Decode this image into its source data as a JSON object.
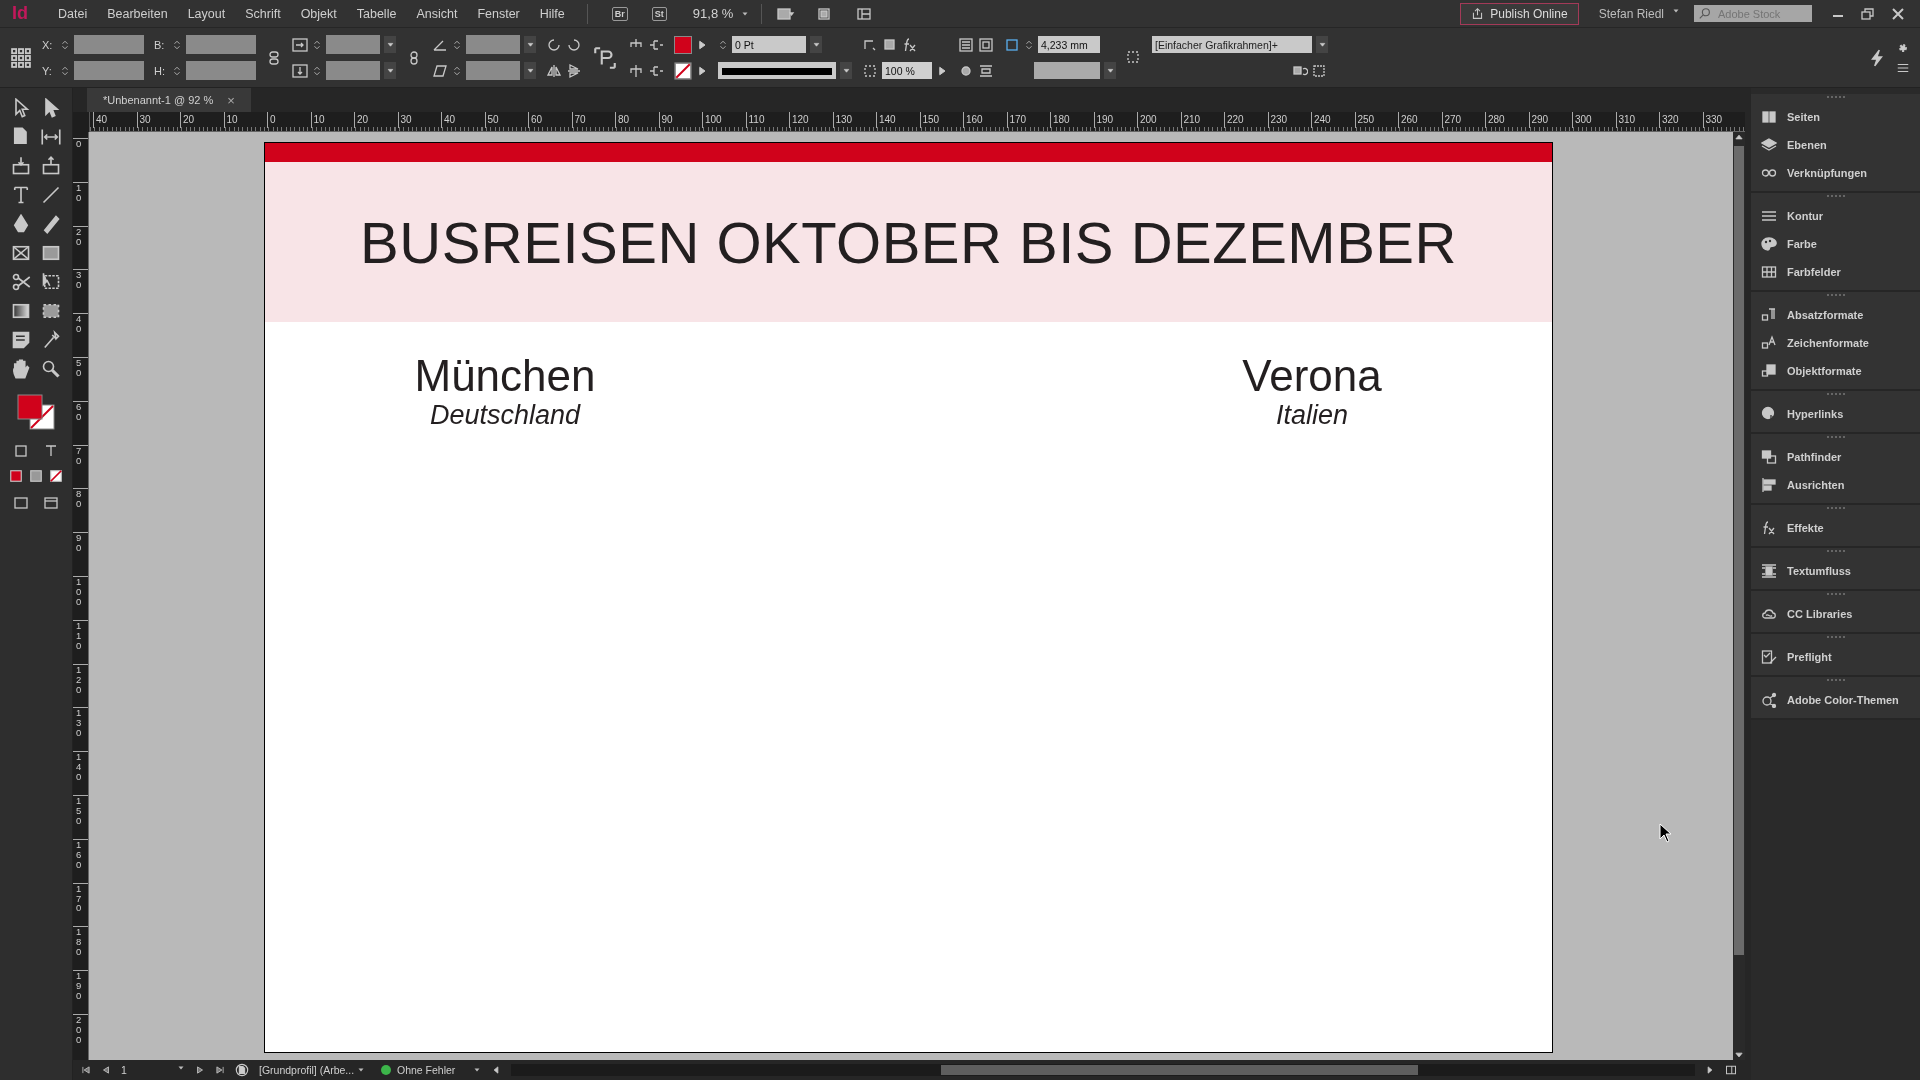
{
  "menubar": {
    "logo": "Id",
    "menus": [
      "Datei",
      "Bearbeiten",
      "Layout",
      "Schrift",
      "Objekt",
      "Tabelle",
      "Ansicht",
      "Fenster",
      "Hilfe"
    ],
    "bridge": "Br",
    "stock": "St",
    "zoom": "91,8 %",
    "publish": "Publish Online",
    "user": "Stefan Riedl",
    "search": {
      "placeholder": "Adobe Stock"
    }
  },
  "control_panel": {
    "x_label": "X:",
    "y_label": "Y:",
    "w_label": "B:",
    "h_label": "H:",
    "stroke_weight": "0 Pt",
    "opacity": "100 %",
    "size": "4,233 mm",
    "object_style": "[Einfacher Grafikrahmen]+"
  },
  "document_tab": {
    "title": "*Unbenannt-1 @ 92 %",
    "close": "×"
  },
  "rulers": {
    "horizontal": [
      "40",
      "30",
      "20",
      "10",
      "0",
      "10",
      "20",
      "30",
      "40",
      "50",
      "60",
      "70",
      "80",
      "90",
      "100",
      "110",
      "120",
      "130",
      "140",
      "150",
      "160",
      "170",
      "180",
      "190",
      "200",
      "210",
      "220",
      "230",
      "240",
      "250",
      "260",
      "270",
      "280",
      "290",
      "300",
      "310",
      "320",
      "330"
    ],
    "vertical": [
      "0",
      "10",
      "20",
      "30",
      "40",
      "50",
      "60",
      "70",
      "80",
      "90",
      "100",
      "110",
      "120",
      "130",
      "140",
      "150",
      "160",
      "170",
      "180",
      "190",
      "200"
    ]
  },
  "page": {
    "title": "BUSREISEN OKTOBER BIS DEZEMBER",
    "destinations": [
      {
        "city": "München",
        "country": "Deutschland"
      },
      {
        "city": "Verona",
        "country": "Italien"
      }
    ]
  },
  "panels": [
    {
      "items": [
        {
          "label": "Seiten",
          "kind": "pages"
        },
        {
          "label": "Ebenen",
          "kind": "layers"
        },
        {
          "label": "Verknüpfungen",
          "kind": "links"
        }
      ]
    },
    {
      "items": [
        {
          "label": "Kontur",
          "kind": "stroke"
        },
        {
          "label": "Farbe",
          "kind": "palette"
        },
        {
          "label": "Farbfelder",
          "kind": "swatches"
        }
      ]
    },
    {
      "items": [
        {
          "label": "Absatzformate",
          "kind": "paragraph"
        },
        {
          "label": "Zeichenformate",
          "kind": "character"
        },
        {
          "label": "Objektformate",
          "kind": "object"
        }
      ]
    },
    {
      "items": [
        {
          "label": "Hyperlinks",
          "kind": "hyperlinks"
        }
      ]
    },
    {
      "items": [
        {
          "label": "Pathfinder",
          "kind": "pathfinder"
        },
        {
          "label": "Ausrichten",
          "kind": "align"
        }
      ]
    },
    {
      "items": [
        {
          "label": "Effekte",
          "kind": "effects"
        }
      ]
    },
    {
      "items": [
        {
          "label": "Textumfluss",
          "kind": "wrap"
        }
      ]
    },
    {
      "items": [
        {
          "label": "CC Libraries",
          "kind": "cloud"
        }
      ]
    },
    {
      "items": [
        {
          "label": "Preflight",
          "kind": "preflight"
        }
      ]
    },
    {
      "items": [
        {
          "label": "Adobe Color-Themen",
          "kind": "color"
        }
      ]
    }
  ],
  "status_bar": {
    "page": "1",
    "profile": "[Grundprofil] (Arbe...",
    "preflight": "Ohne Fehler"
  }
}
